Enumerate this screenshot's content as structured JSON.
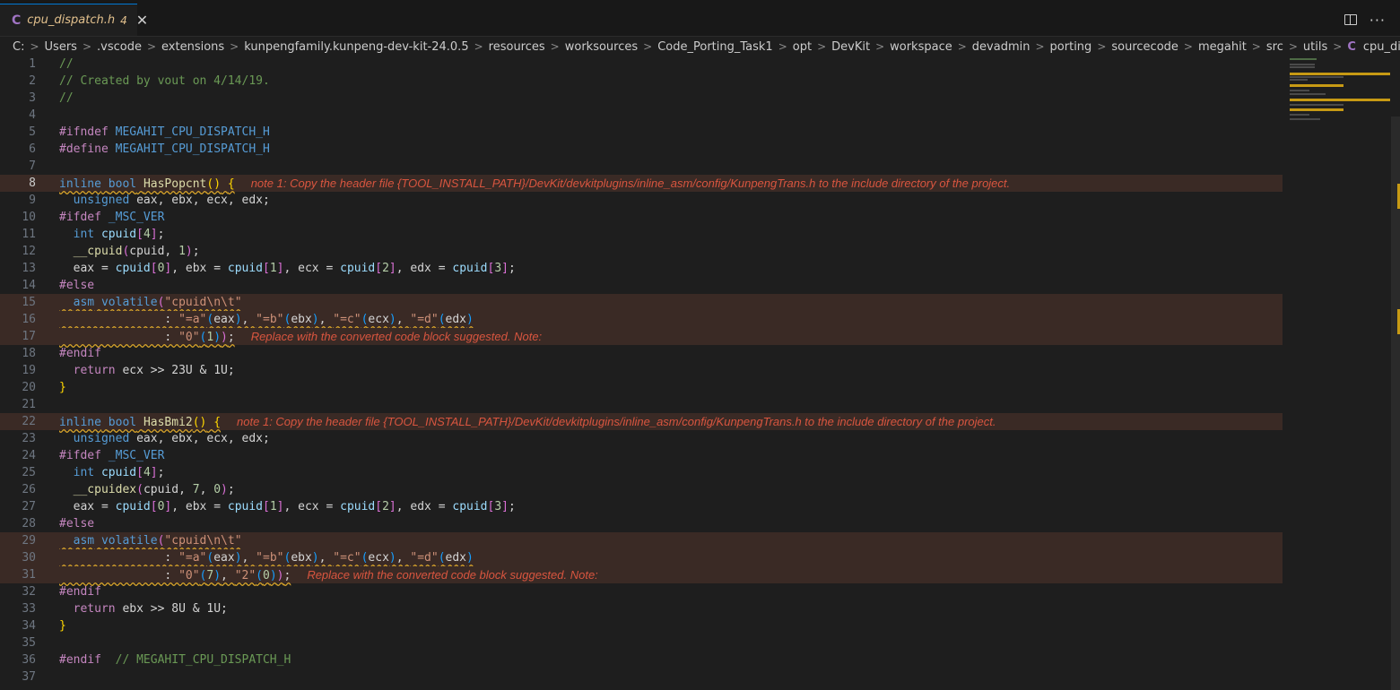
{
  "tab": {
    "icon": "C",
    "filename": "cpu_dispatch.h",
    "problem_count": "4",
    "close": "✕"
  },
  "actions": {
    "split_icon": "split-editor-icon",
    "more": "···"
  },
  "breadcrumb": {
    "items": [
      "C:",
      "Users",
      "",
      ".vscode",
      "extensions",
      "kunpengfamily.kunpeng-dev-kit-24.0.5",
      "resources",
      "worksources",
      "Code_Porting_Task1",
      "opt",
      "DevKit",
      "workspace",
      "devadmin",
      "porting",
      "sourcecode",
      "megahit",
      "src",
      "utils"
    ],
    "file_icon": "C",
    "file": "cpu_dispatch.h"
  },
  "annotations": {
    "note1": "note 1: Copy the header file {TOOL_INSTALL_PATH}/DevKit/devkitplugins/inline_asm/config/KunpengTrans.h to the include directory of the project.",
    "replace": "Replace with the converted code block suggested. Note:"
  },
  "lines": [
    "1",
    "2",
    "3",
    "4",
    "5",
    "6",
    "7",
    "8",
    "9",
    "10",
    "11",
    "12",
    "13",
    "14",
    "15",
    "16",
    "17",
    "18",
    "19",
    "20",
    "21",
    "22",
    "23",
    "24",
    "25",
    "26",
    "27",
    "28",
    "29",
    "30",
    "31",
    "32",
    "33",
    "34",
    "35",
    "36",
    "37"
  ],
  "code": {
    "l1": "//",
    "l2": "// Created by vout on 4/14/19.",
    "l3": "//",
    "l5_pp": "#ifndef",
    "l5_mac": "MEGAHIT_CPU_DISPATCH_H",
    "l6_pp": "#define",
    "l6_mac": "MEGAHIT_CPU_DISPATCH_H",
    "inline": "inline",
    "bool": "bool",
    "fn1": "HasPopcnt",
    "fn2": "HasBmi2",
    "unsigned": "unsigned",
    "regs_decl": "eax, ebx, ecx, edx;",
    "ifdef": "#ifdef",
    "msc": "_MSC_VER",
    "int": "int",
    "cpuid": "cpuid",
    "cpuid_fn": "__cpuid",
    "cpuidex_fn": "__cpuidex",
    "else": "#else",
    "asm": "asm",
    "volatile": "volatile",
    "asm_str": "\"cpuid\\n\\t\"",
    "eax_c": "\"=a\"",
    "ebx_c": "\"=b\"",
    "ecx_c": "\"=c\"",
    "edx_c": "\"=d\"",
    "zero_c": "\"0\"",
    "two_c": "\"2\"",
    "endif": "#endif",
    "ret": "return",
    "ret1": "ecx >> 23U & 1U;",
    "ret2": "ebx >> 8U & 1U;",
    "final_endif": "#endif",
    "final_comment": "// MEGAHIT_CPU_DISPATCH_H"
  }
}
